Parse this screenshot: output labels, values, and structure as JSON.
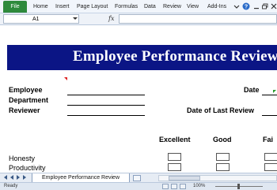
{
  "ribbon": {
    "file_label": "File",
    "tabs": [
      "Home",
      "Insert",
      "Page Layout",
      "Formulas",
      "Data",
      "Review",
      "View",
      "Add-Ins"
    ]
  },
  "formula_bar": {
    "name_box": "A1",
    "fx_label": "fx",
    "formula": ""
  },
  "sheet": {
    "title": "Employee Performance Review",
    "labels": {
      "employee": "Employee",
      "department": "Department",
      "reviewer": "Reviewer",
      "date": "Date",
      "date_last_review": "Date of Last Review"
    },
    "ratings": [
      "Excellent",
      "Good",
      "Fai"
    ],
    "criteria": [
      "Honesty",
      "Productivity"
    ]
  },
  "tabs": {
    "active": "Employee Performance Review"
  },
  "status": {
    "ready": "Ready",
    "zoom": "100%"
  },
  "colors": {
    "banner": "#0b1585",
    "file_tab": "#2e8a3c"
  }
}
